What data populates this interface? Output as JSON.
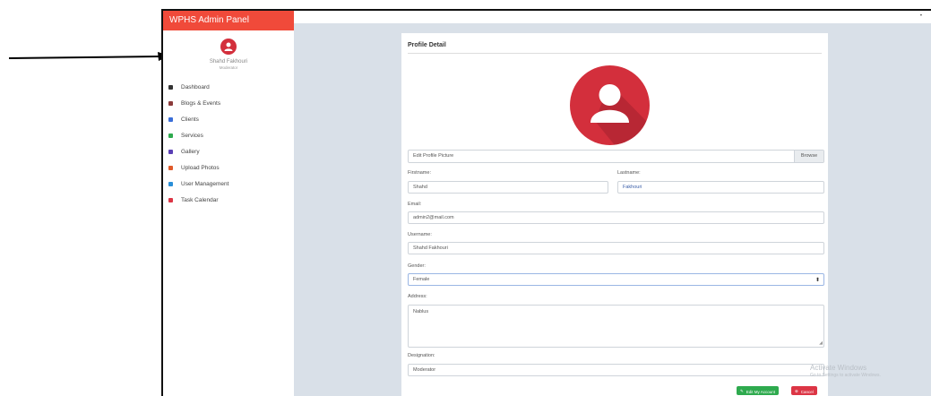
{
  "app": {
    "brand": "WPHS Admin Panel"
  },
  "user": {
    "name": "Shahd Fakhouri",
    "role": "Moderator"
  },
  "nav": [
    {
      "label": "Dashboard",
      "icon": "home-icon",
      "color": "#333333"
    },
    {
      "label": "Blogs & Events",
      "icon": "blog-icon",
      "color": "#8b3a3a"
    },
    {
      "label": "Clients",
      "icon": "users-icon",
      "color": "#3a6ed8"
    },
    {
      "label": "Services",
      "icon": "shield-icon",
      "color": "#2eaa4e"
    },
    {
      "label": "Gallery",
      "icon": "gallery-icon",
      "color": "#5a3fb5"
    },
    {
      "label": "Upload Photos",
      "icon": "upload-icon",
      "color": "#e05a2a"
    },
    {
      "label": "User Management",
      "icon": "id-card-icon",
      "color": "#2a8fd8"
    },
    {
      "label": "Task Calendar",
      "icon": "calendar-icon",
      "color": "#dc3545"
    }
  ],
  "profile": {
    "title": "Profile Detail",
    "picture_label": "Edit Profile Picture",
    "browse": "Browse",
    "firstname_label": "Firstname:",
    "firstname": "Shahd",
    "lastname_label": "Lastname:",
    "lastname": "Fakhouri",
    "email_label": "Email:",
    "email": "admin2@mail.com",
    "username_label": "Username:",
    "username": "Shahd Fakhouri",
    "gender_label": "Gender:",
    "gender": "Female",
    "address_label": "Address:",
    "address": "Nablus",
    "designation_label": "Designation:",
    "designation": "Moderator",
    "edit_button": "Edit My Account",
    "cancel_button": "Cancel"
  },
  "watermark": {
    "line1": "Activate Windows",
    "line2": "Go to Settings to activate Windows."
  },
  "colors": {
    "brand": "#f04a3a",
    "avatar": "#d32f3c",
    "panel_bg": "#d9e0e8",
    "edit": "#2eaa4e",
    "cancel": "#dc3545"
  }
}
